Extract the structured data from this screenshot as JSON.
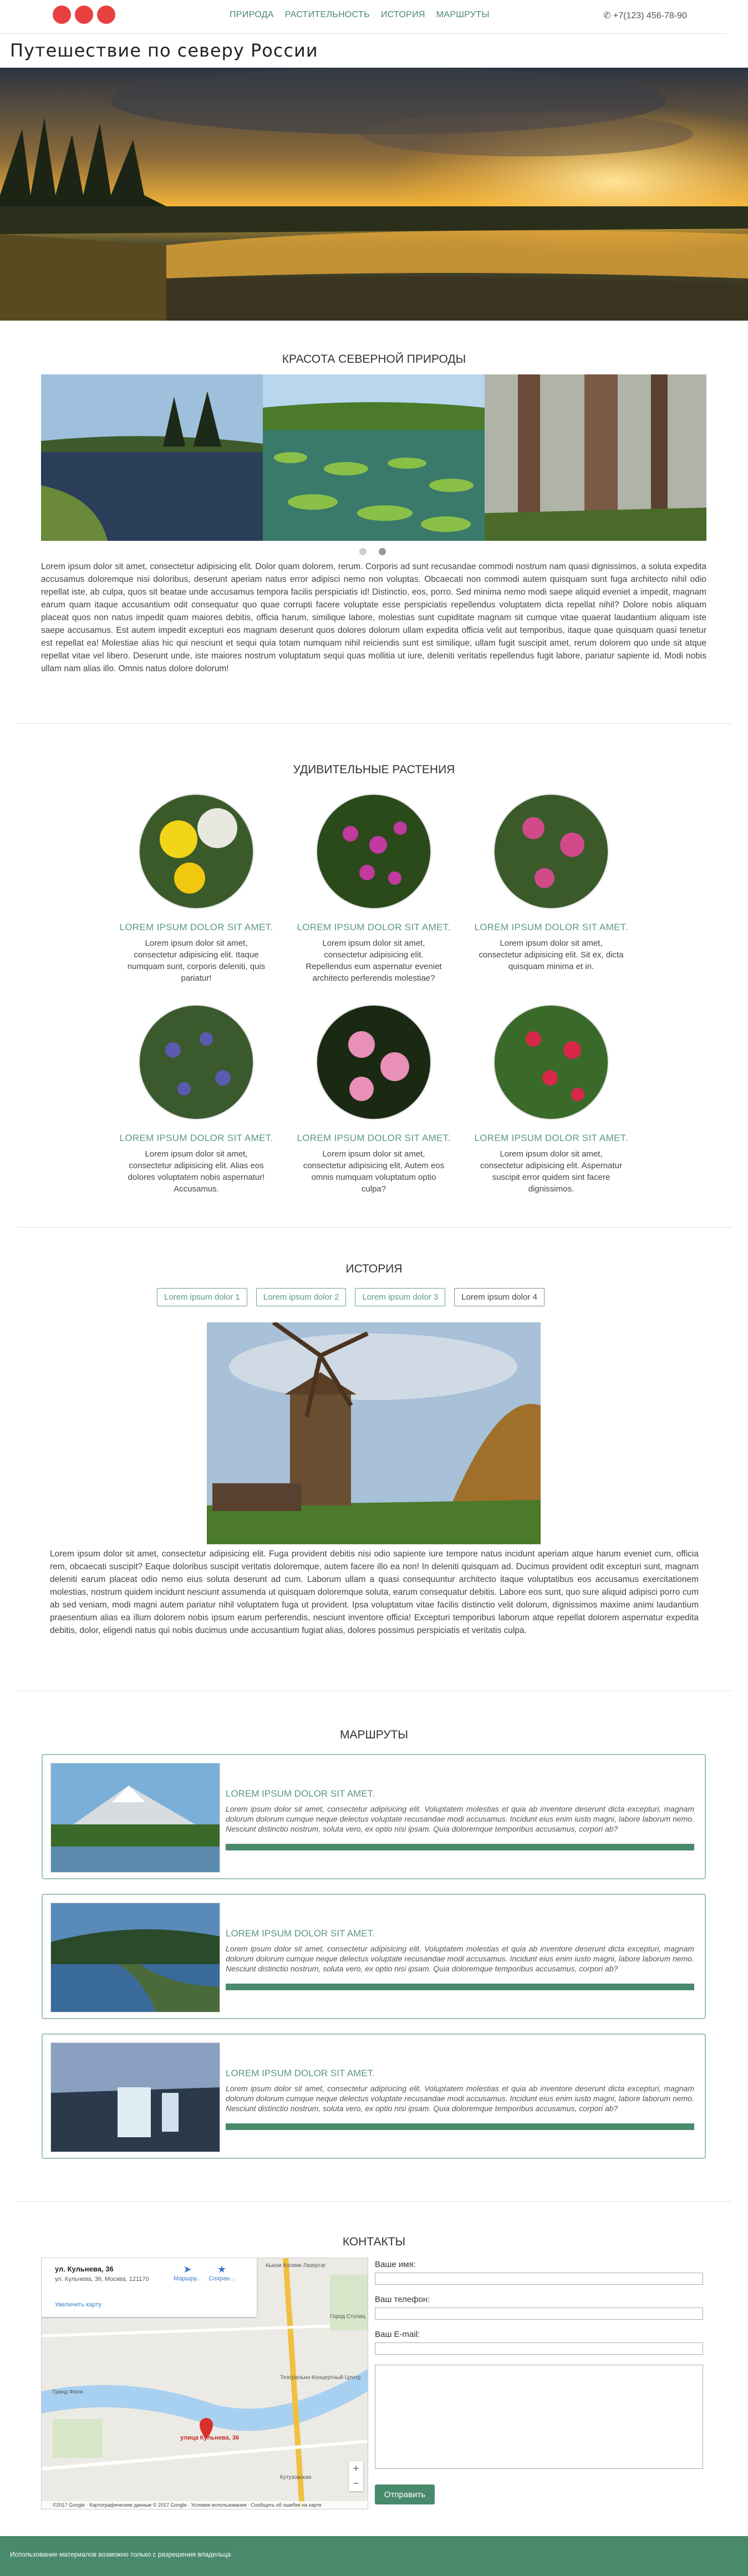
{
  "header": {
    "nav": [
      "ПРИРОДА",
      "РАСТИТЕЛЬНОСТЬ",
      "ИСТОРИЯ",
      "МАРШРУТЫ"
    ],
    "phone": "+7(123) 456-78-90",
    "phone_icon": "phone-icon",
    "logo_dots": [
      "#e8403e",
      "#e8403e",
      "#e8403e"
    ]
  },
  "site_title": "Путешествие по северу России",
  "nature": {
    "title": "КРАСОТА СЕВЕРНОЙ ПРИРОДЫ",
    "text": "Lorem ipsum dolor sit amet, consectetur adipisicing elit. Dolor quam dolorem, rerum. Corporis ad sunt recusandae commodi nostrum nam quasi dignissimos, a soluta expedita accusamus doloremque nisi doloribus, deserunt aperiam natus error adipisci nemo non voluptas. Obcaecati non commodi autem quisquam sunt fuga architecto nihil odio repellat iste, ab culpa, quos sit beatae unde accusamus tempora facilis perspiciatis id! Distinctio, eos, porro. Sed minima nemo modi saepe aliquid eveniet a impedit, magnam earum quam itaque accusantium odit consequatur quo quae corrupti facere voluptate esse perspiciatis repellendus voluptatem dicta repellat nihil? Dolore nobis aliquam placeat quos non natus impedit quam maiores debitis, officia harum, similique labore, molestias sunt cupiditate magnam sit cumque vitae quaerat laudantium aliquam iste saepe accusamus. Est autem impedit excepturi eos magnam deserunt quos dolores dolorum ullam expedita officia velit aut temporibus, itaque quae quisquam quasi tenetur est repellat ea! Molestiae alias hic qui nesciunt et sequi quia totam numquam nihil reiciendis sunt est similique, ullam fugit suscipit amet, rerum dolorem quo unde sit atque repellat vitae vel libero. Deserunt unde, iste maiores nostrum voluptatum sequi quas mollitia ut iure, deleniti veritatis repellendus fugit labore, pariatur sapiente id. Modi nobis ullam nam alias illo. Omnis natus dolore dolorum!"
  },
  "plants": {
    "title": "УДИВИТЕЛЬНЫЕ РАСТЕНИЯ",
    "items": [
      {
        "heading": "LOREM IPSUM DOLOR SIT AMET.",
        "text": "Lorem ipsum dolor sit amet, consectetur adipisicing elit. Itaque numquam sunt, corporis deleniti, quis pariatur!"
      },
      {
        "heading": "LOREM IPSUM DOLOR SIT AMET.",
        "text": "Lorem ipsum dolor sit amet, consectetur adipisicing elit. Repellendus eum aspernatur eveniet architecto perferendis molestiae?"
      },
      {
        "heading": "LOREM IPSUM DOLOR SIT AMET.",
        "text": "Lorem ipsum dolor sit amet, consectetur adipisicing elit. Sit ex, dicta quisquam minima et in."
      },
      {
        "heading": "LOREM IPSUM DOLOR SIT AMET.",
        "text": "Lorem ipsum dolor sit amet, consectetur adipisicing elit. Alias eos dolores voluptatem nobis aspernatur! Accusamus."
      },
      {
        "heading": "LOREM IPSUM DOLOR SIT AMET.",
        "text": "Lorem ipsum dolor sit amet, consectetur adipisicing elit. Autem eos omnis numquam voluptatum optio culpa?"
      },
      {
        "heading": "LOREM IPSUM DOLOR SIT AMET.",
        "text": "Lorem ipsum dolor sit amet, consectetur adipisicing elit. Aspernatur suscipit error quidem sint facere dignissimos."
      }
    ]
  },
  "history": {
    "title": "ИСТОРИЯ",
    "tabs": [
      "Lorem ipsum dolor 1",
      "Lorem ipsum dolor 2",
      "Lorem ipsum dolor 3",
      "Lorem ipsum dolor 4"
    ],
    "active_tab": "Lorem ipsum dolor 4",
    "text": "Lorem ipsum dolor sit amet, consectetur adipisicing elit. Fuga provident debitis nisi odio sapiente iure tempore natus incidunt aperiam atque harum eveniet cum, officia rem, obcaecati suscipit? Eaque doloribus suscipit veritatis doloremque, autem facere illo ea non! In deleniti quisquam ad. Ducimus provident odit excepturi sunt, magnam deleniti earum placeat odio nemo eius soluta deserunt ad cum. Laborum ullam a quasi consequuntur architecto itaque voluptatibus eos accusamus exercitationem molestias, nostrum quidem incidunt nesciunt assumenda ut quisquam doloremque soluta, earum consequatur debitis. Labore eos sunt, quo sure aliquid adipisci porro cum ab sed veniam, modi magni autem pariatur nihil voluptatem fuga ut provident. Ipsa voluptatum vitae facilis distinctio velit dolorum, dignissimos maxime animi laudantium praesentium alias ea illum dolorem nobis ipsum earum perferendis, nesciunt inventore officia! Excepturi temporibus laborum atque repellat dolorem aspernatur expedita debitis, dolor, eligendi natus qui nobis ducimus unde accusantium fugiat alias, dolores possimus perspiciatis et veritatis culpa."
  },
  "routes": {
    "title": "МАРШРУТЫ",
    "items": [
      {
        "heading": "LOREM IPSUM DOLOR SIT AMET.",
        "text": "Lorem ipsum dolor sit amet, consectetur adipisicing elit. Voluptatem molestias et quia ab inventore deserunt dicta excepturi, magnam dolorum dolorum cumque neque delectus voluptate recusandae modi accusamus. Incidunt eius enim iusto magni, labore laborum nemo. Nesciunt distinctio nostrum, soluta vero, ex optio nisi ipsam. Quia doloremque temporibus accusamus, corpori ab?"
      },
      {
        "heading": "LOREM IPSUM DOLOR SIT AMET.",
        "text": "Lorem ipsum dolor sit amet, consectetur adipisicing elit. Voluptatem molestias et quia ab inventore deserunt dicta excepturi, magnam dolorum dolorum cumque neque delectus voluptate recusandae modi accusamus. Incidunt eius enim iusto magni, labore laborum nemo. Nesciunt distinctio nostrum, soluta vero, ex optio nisi ipsam. Quia doloremque temporibus accusamus, corpori ab?"
      },
      {
        "heading": "LOREM IPSUM DOLOR SIT AMET.",
        "text": "Lorem ipsum dolor sit amet, consectetur adipisicing elit. Voluptatem molestias et quia ab inventore deserunt dicta excepturi, magnam dolorum dolorum cumque neque delectus voluptate recusandae modi accusamus. Incidunt eius enim iusto magni, labore laborum nemo. Nesciunt distinctio nostrum, soluta vero, ex optio nisi ipsam. Quia doloremque temporibus accusamus, corpori ab?"
      }
    ]
  },
  "contacts": {
    "title": "КОНТАКТЫ",
    "map": {
      "place_title": "ул. Кульнева, 36",
      "place_address": "ул. Кульнева, 36, Москва, 121170",
      "route_label": "Маршру...",
      "save_label": "Сохран...",
      "larger_map": "Увеличить карту",
      "pin_label": "улица Кульнева, 36",
      "labels": [
        "Кьюзи Космик Лазертаг",
        "Город Столиц",
        "Театрально-Концертный Центр",
        "Кутузовская",
        "Гранд Фили"
      ],
      "footer": "©2017 Google · Картографические данные © 2017 Google · Условия использования · Сообщить об ошибке на карте"
    },
    "form": {
      "name_label": "Ваше имя:",
      "phone_label": "Ваш телефон:",
      "email_label": "Ваш E-mail:",
      "send_label": "Отправить"
    }
  },
  "footer": {
    "text": "Использование материалов возможно только с разрешения владельца",
    "color": "#4a8a6c"
  },
  "colors": {
    "accent": "#4a8a6c",
    "logo": "#e8403e"
  }
}
